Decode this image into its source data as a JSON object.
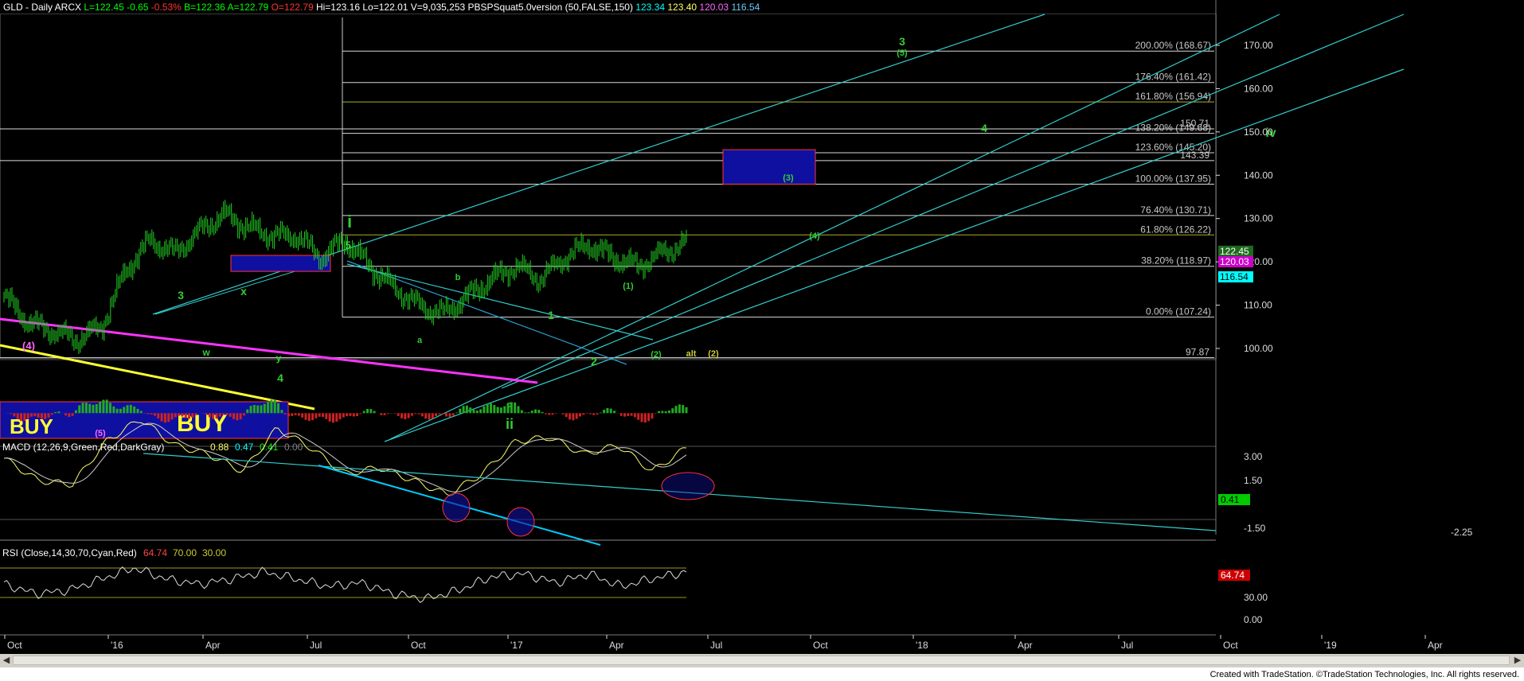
{
  "header": {
    "symbol": "GLD - Daily  ARCX",
    "stats": [
      {
        "text": "L=122.45",
        "color": "#00ff00"
      },
      {
        "text": "-0.65",
        "color": "#00ff00"
      },
      {
        "text": "-0.53%",
        "color": "#ff3333"
      },
      {
        "text": "B=122.36",
        "color": "#00ff00"
      },
      {
        "text": "A=122.79",
        "color": "#00ff00"
      },
      {
        "text": "O=122.79",
        "color": "#ff3333"
      },
      {
        "text": "Hi=123.16",
        "color": "#ffffff"
      },
      {
        "text": "Lo=122.01",
        "color": "#ffffff"
      },
      {
        "text": "V=9,035,253",
        "color": "#ffffff"
      },
      {
        "text": "PBSPSquat5.0version (50,FALSE,150)",
        "color": "#ffffff"
      },
      {
        "text": "123.34",
        "color": "#00ffff"
      },
      {
        "text": "123.40",
        "color": "#ffff66"
      },
      {
        "text": "120.03",
        "color": "#ff66ff"
      },
      {
        "text": "116.54",
        "color": "#66ccff"
      }
    ]
  },
  "price_axis": {
    "ticks": [
      "170.00",
      "160.00",
      "150.00",
      "140.00",
      "130.00",
      "120.00",
      "110.00",
      "100.00"
    ],
    "badges": [
      {
        "text": "122.45",
        "bg": "#1e6b1e",
        "fg": "#ffffff",
        "value": 122.45
      },
      {
        "text": "120.03",
        "bg": "#cc00cc",
        "fg": "#ffffff",
        "value": 120.03
      },
      {
        "text": "116.54",
        "bg": "#00ffff",
        "fg": "#000000",
        "value": 116.54
      }
    ]
  },
  "fib_levels": [
    {
      "label": "200.00% (168.67)",
      "value": 168.67,
      "color": "#ffffff"
    },
    {
      "label": "176.40% (161.42)",
      "value": 161.42,
      "color": "#ffffff"
    },
    {
      "label": "161.80% (156.94)",
      "value": 156.94,
      "color": "#cccc33"
    },
    {
      "label": "138.20% (149.68)",
      "value": 149.68,
      "color": "#ffffff"
    },
    {
      "label": "123.60% (145.20)",
      "value": 145.2,
      "color": "#ffffff"
    },
    {
      "label": "100.00% (137.95)",
      "value": 137.95,
      "color": "#ffffff"
    },
    {
      "label": "76.40% (130.71)",
      "value": 130.71,
      "color": "#ffffff"
    },
    {
      "label": "61.80% (126.22)",
      "value": 126.22,
      "color": "#cccc33"
    },
    {
      "label": "38.20% (118.97)",
      "value": 118.97,
      "color": "#ffffff"
    },
    {
      "label": "0.00% (107.24)",
      "value": 107.24,
      "color": "#ffffff"
    }
  ],
  "extra_levels": [
    {
      "label": "150.71",
      "value": 150.71
    },
    {
      "label": "143.39",
      "value": 143.39
    },
    {
      "label": "97.87",
      "value": 97.87
    }
  ],
  "wave_labels": [
    {
      "text": "3",
      "color": "#33cc33",
      "size": 14
    },
    {
      "text": "(5)",
      "color": "#33cc33",
      "size": 11
    },
    {
      "text": "4",
      "color": "#33cc33",
      "size": 14
    },
    {
      "text": "iv",
      "color": "#33cc33",
      "size": 16
    },
    {
      "text": "(3)",
      "color": "#33cc33",
      "size": 11
    },
    {
      "text": "(4)",
      "color": "#33cc33",
      "size": 11
    },
    {
      "text": "i",
      "color": "#33cc33",
      "size": 22
    },
    {
      "text": "5",
      "color": "#33cc33",
      "size": 14
    },
    {
      "text": "b",
      "color": "#33cc33",
      "size": 11
    },
    {
      "text": "a",
      "color": "#33cc33",
      "size": 11
    },
    {
      "text": "c",
      "color": "#33cc33",
      "size": 11
    },
    {
      "text": "ii",
      "color": "#33cc33",
      "size": 18
    },
    {
      "text": "1",
      "color": "#33cc33",
      "size": 14
    },
    {
      "text": "2",
      "color": "#33cc33",
      "size": 14
    },
    {
      "text": "(1)",
      "color": "#33cc33",
      "size": 11
    },
    {
      "text": "(2)",
      "color": "#33cc33",
      "size": 11
    },
    {
      "text": "alt",
      "color": "#cccc33",
      "size": 11
    },
    {
      "text": "(2)",
      "color": "#cccc33",
      "size": 11
    },
    {
      "text": "3",
      "color": "#33cc33",
      "size": 14
    },
    {
      "text": "x",
      "color": "#33cc33",
      "size": 14
    },
    {
      "text": "w",
      "color": "#33cc33",
      "size": 12
    },
    {
      "text": "y",
      "color": "#33cc33",
      "size": 12
    },
    {
      "text": "4",
      "color": "#33cc33",
      "size": 14
    },
    {
      "text": "(4)",
      "color": "#ff66ff",
      "size": 13
    },
    {
      "text": "(5)",
      "color": "#ff66ff",
      "size": 11
    }
  ],
  "buy_labels": [
    "BUY",
    "BUY"
  ],
  "macd": {
    "label": "MACD (12,26,9,Green,Red,DarkGray)",
    "values": [
      {
        "text": "0.88",
        "color": "#ffff66"
      },
      {
        "text": "0.47",
        "color": "#00ffff"
      },
      {
        "text": "0.41",
        "color": "#00ff00"
      },
      {
        "text": "0.00",
        "color": "#808080"
      }
    ],
    "ticks": [
      "3.00",
      "1.50",
      "-1.50"
    ],
    "badge": {
      "text": "0.41",
      "value": 0.41
    },
    "trend_label": "-2.25"
  },
  "rsi": {
    "label": "RSI (Close,14,30,70,Cyan,Red)",
    "values": [
      {
        "text": "64.74",
        "color": "#ff4444"
      },
      {
        "text": "70.00",
        "color": "#cccc33"
      },
      {
        "text": "30.00",
        "color": "#cccc33"
      }
    ],
    "ticks": [
      "30.00",
      "0.00"
    ],
    "badge": {
      "text": "64.74",
      "value": 64.74
    }
  },
  "time_axis": [
    "Oct",
    "'16",
    "Apr",
    "Jul",
    "Oct",
    "'17",
    "Apr",
    "Jul",
    "Oct",
    "'18",
    "Apr",
    "Jul",
    "Oct",
    "'19",
    "Apr"
  ],
  "footer": "Created with TradeStation. ©TradeStation Technologies, Inc. All rights reserved.",
  "chart_data": {
    "type": "line",
    "title": "GLD - Daily  ARCX",
    "price_range": [
      95,
      176
    ],
    "x": [
      "Oct",
      "'16",
      "Apr",
      "Jul",
      "Oct",
      "'17",
      "Apr",
      "Jul",
      "Oct",
      "'18",
      "Apr",
      "Jul",
      "Oct",
      "'19",
      "Apr"
    ],
    "series": [
      {
        "name": "GLD",
        "values": [
          112,
          106,
          104,
          102,
          105,
          118,
          125,
          122,
          127,
          131,
          128,
          126,
          126,
          121,
          125,
          119,
          114,
          110,
          108,
          112,
          116,
          119,
          116,
          121,
          124,
          121,
          119,
          122,
          124.5
        ]
      },
      {
        "name": "MACD",
        "values": [
          0.2,
          -1.5,
          -1.8,
          1.5,
          3.2,
          1.2,
          0.5,
          -0.8,
          2.5,
          1.0,
          -1.0,
          -0.5,
          -1.5,
          -2.6,
          -1.0,
          1.5,
          1.8,
          0.5,
          1.2,
          -0.8,
          1.0
        ]
      },
      {
        "name": "RSI",
        "values": [
          48,
          35,
          40,
          55,
          70,
          55,
          48,
          55,
          65,
          55,
          45,
          50,
          35,
          28,
          40,
          58,
          62,
          50,
          62,
          45,
          56,
          64.74
        ]
      }
    ],
    "grid": false
  }
}
